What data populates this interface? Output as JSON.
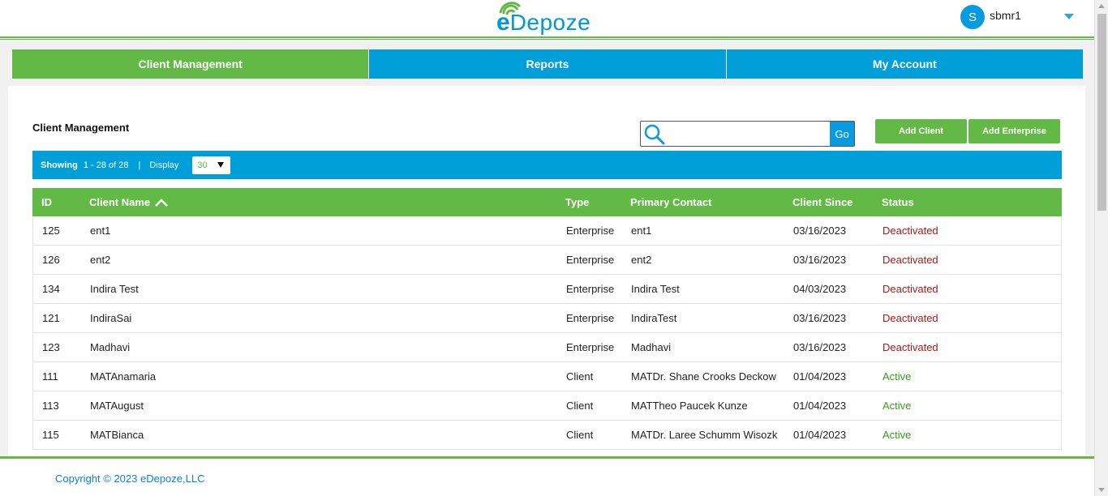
{
  "brand": {
    "logo_e": "e",
    "logo_rest": "Depoze",
    "color": "#0098d6",
    "accent": "#62b945"
  },
  "user": {
    "initial": "S",
    "name": "sbmr1"
  },
  "nav": {
    "tabs": [
      {
        "label": "Client Management",
        "active": true
      },
      {
        "label": "Reports",
        "active": false
      },
      {
        "label": "My Account",
        "active": false
      }
    ]
  },
  "main": {
    "title": "Client Management",
    "search": {
      "placeholder": "",
      "go_label": "Go"
    },
    "add_client_label": "Add Client",
    "add_enterprise_label": "Add Enterprise",
    "toolbar": {
      "showing_label": "Showing",
      "range": "1 - 28 of 28",
      "separator": "|",
      "display_label": "Display",
      "display_value": "30"
    },
    "table": {
      "headers": {
        "id": "ID",
        "name": "Client Name",
        "type": "Type",
        "contact": "Primary Contact",
        "since": "Client Since",
        "status": "Status"
      },
      "rows": [
        {
          "id": "125",
          "name": "ent1",
          "type": "Enterprise",
          "contact": "ent1",
          "since": "03/16/2023",
          "status": "Deactivated"
        },
        {
          "id": "126",
          "name": "ent2",
          "type": "Enterprise",
          "contact": "ent2",
          "since": "03/16/2023",
          "status": "Deactivated"
        },
        {
          "id": "134",
          "name": "Indira Test",
          "type": "Enterprise",
          "contact": "Indira Test",
          "since": "04/03/2023",
          "status": "Deactivated"
        },
        {
          "id": "121",
          "name": "IndiraSai",
          "type": "Enterprise",
          "contact": "IndiraTest",
          "since": "03/16/2023",
          "status": "Deactivated"
        },
        {
          "id": "123",
          "name": "Madhavi",
          "type": "Enterprise",
          "contact": "Madhavi",
          "since": "03/16/2023",
          "status": "Deactivated"
        },
        {
          "id": "111",
          "name": "MATAnamaria",
          "type": "Client",
          "contact": "MATDr. Shane Crooks Deckow",
          "since": "01/04/2023",
          "status": "Active"
        },
        {
          "id": "113",
          "name": "MATAugust",
          "type": "Client",
          "contact": "MATTheo Paucek Kunze",
          "since": "01/04/2023",
          "status": "Active"
        },
        {
          "id": "115",
          "name": "MATBianca",
          "type": "Client",
          "contact": "MATDr. Laree Schumm Wisozk",
          "since": "01/04/2023",
          "status": "Active"
        }
      ]
    }
  },
  "footer": {
    "copyright": "Copyright © 2023 eDepoze,LLC"
  },
  "icons": {
    "search": "search-icon",
    "sort": "chevron-up-icon",
    "caret": "caret-down-icon",
    "wifi": "wifi-icon"
  }
}
